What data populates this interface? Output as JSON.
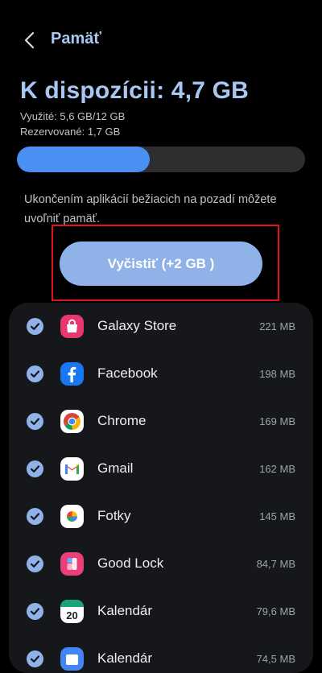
{
  "header": {
    "title": "Pamäť"
  },
  "memory": {
    "available": "K dispozícii: 4,7 GB",
    "used": "Využité: 5,6 GB/12 GB",
    "reserved": "Rezervované: 1,7 GB",
    "usage_fraction": 0.46
  },
  "info_text": "Ukončením aplikácií bežiacich na pozadí môžete uvoľniť pamäť.",
  "clean_button": {
    "label": "Vyčistiť (+2 GB )"
  },
  "apps": [
    {
      "name": "Galaxy Store",
      "size": "221 MB",
      "icon": "galaxy-store-icon"
    },
    {
      "name": "Facebook",
      "size": "198 MB",
      "icon": "facebook-icon"
    },
    {
      "name": "Chrome",
      "size": "169 MB",
      "icon": "chrome-icon"
    },
    {
      "name": "Gmail",
      "size": "162 MB",
      "icon": "gmail-icon"
    },
    {
      "name": "Fotky",
      "size": "145 MB",
      "icon": "photos-icon"
    },
    {
      "name": "Good Lock",
      "size": "84,7 MB",
      "icon": "good-lock-icon"
    },
    {
      "name": "Kalendár",
      "size": "79,6 MB",
      "icon": "calendar-icon",
      "icon_text": "20"
    },
    {
      "name": "Kalendár",
      "size": "74,5 MB",
      "icon": "calendar-app-icon"
    }
  ],
  "colors": {
    "accent": "#a9c7f2",
    "bar_fill": "#4a8ff2",
    "button": "#8fb3e8",
    "highlight": "#e0141e"
  }
}
